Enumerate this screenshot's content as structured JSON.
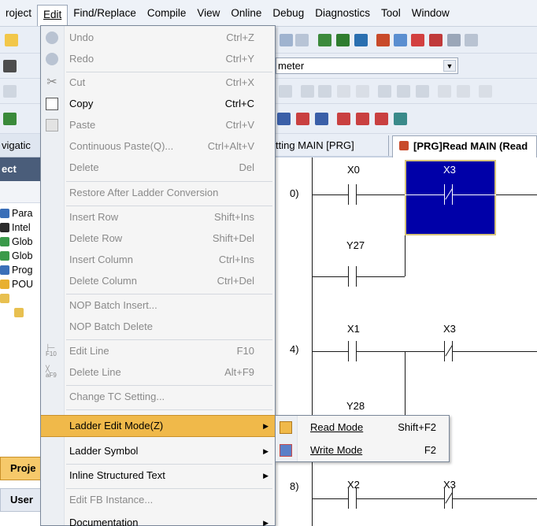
{
  "menubar": {
    "items": [
      "roject",
      "Edit",
      "Find/Replace",
      "Compile",
      "View",
      "Online",
      "Debug",
      "Diagnostics",
      "Tool",
      "Window"
    ],
    "active_index": 1
  },
  "toolbar": {
    "parameter_combo": "meter"
  },
  "tabs": {
    "tab1": "tting MAIN [PRG]",
    "tab2": "[PRG]Read MAIN (Read"
  },
  "left_panel": {
    "header_nav": "vigatic",
    "header_project": "ect",
    "tree": [
      "Para",
      "Intel",
      "Glob",
      "Glob",
      "Prog",
      "POU"
    ],
    "bottom_tab1": "Proje",
    "bottom_tab2": "User"
  },
  "edit_menu": {
    "items": [
      {
        "label": "Undo",
        "shortcut": "Ctrl+Z",
        "disabled": true,
        "icon": "undo-icon"
      },
      {
        "label": "Redo",
        "shortcut": "Ctrl+Y",
        "disabled": true,
        "icon": "redo-icon"
      },
      {
        "label": "Cut",
        "shortcut": "Ctrl+X",
        "disabled": true,
        "icon": "cut-icon"
      },
      {
        "label": "Copy",
        "shortcut": "Ctrl+C",
        "disabled": false,
        "icon": "copy-icon"
      },
      {
        "label": "Paste",
        "shortcut": "Ctrl+V",
        "disabled": true,
        "icon": "paste-icon"
      },
      {
        "label": "Continuous Paste(Q)...",
        "shortcut": "Ctrl+Alt+V",
        "disabled": true
      },
      {
        "label": "Delete",
        "shortcut": "Del",
        "disabled": true
      },
      {
        "label": "Restore After Ladder Conversion",
        "shortcut": "",
        "disabled": true
      },
      {
        "label": "Insert Row",
        "shortcut": "Shift+Ins",
        "disabled": true
      },
      {
        "label": "Delete Row",
        "shortcut": "Shift+Del",
        "disabled": true
      },
      {
        "label": "Insert Column",
        "shortcut": "Ctrl+Ins",
        "disabled": true
      },
      {
        "label": "Delete Column",
        "shortcut": "Ctrl+Del",
        "disabled": true
      },
      {
        "label": "NOP Batch Insert...",
        "shortcut": "",
        "disabled": true
      },
      {
        "label": "NOP Batch Delete",
        "shortcut": "",
        "disabled": true
      },
      {
        "label": "Edit Line",
        "shortcut": "F10",
        "disabled": true,
        "icon": "edit-line-icon"
      },
      {
        "label": "Delete Line",
        "shortcut": "Alt+F9",
        "disabled": true,
        "icon": "delete-line-icon"
      },
      {
        "label": "Change TC Setting...",
        "shortcut": "",
        "disabled": true
      },
      {
        "label": "Ladder Edit Mode(Z)",
        "shortcut": "",
        "disabled": false,
        "submenu": true,
        "highlighted": true
      },
      {
        "label": "Ladder Symbol",
        "shortcut": "",
        "disabled": false,
        "submenu": true
      },
      {
        "label": "Inline Structured Text",
        "shortcut": "",
        "disabled": false,
        "submenu": true
      },
      {
        "label": "Edit FB Instance...",
        "shortcut": "",
        "disabled": true
      },
      {
        "label": "Documentation",
        "shortcut": "",
        "disabled": false,
        "submenu": true
      }
    ]
  },
  "submenu": {
    "items": [
      {
        "label": "Read Mode",
        "shortcut": "Shift+F2",
        "icon": "read-mode-icon"
      },
      {
        "label": "Write Mode",
        "shortcut": "F2",
        "icon": "write-mode-icon"
      }
    ]
  },
  "ladder": {
    "step_numbers": [
      "0)",
      "4)",
      "8)"
    ],
    "contacts": [
      "X0",
      "X3",
      "Y27",
      "X1",
      "X3",
      "Y28",
      "X2",
      "X3"
    ]
  },
  "colors": {
    "highlight": "#f0b94a",
    "selection": "#0000a8",
    "menu_bg": "#f5f5f5"
  }
}
